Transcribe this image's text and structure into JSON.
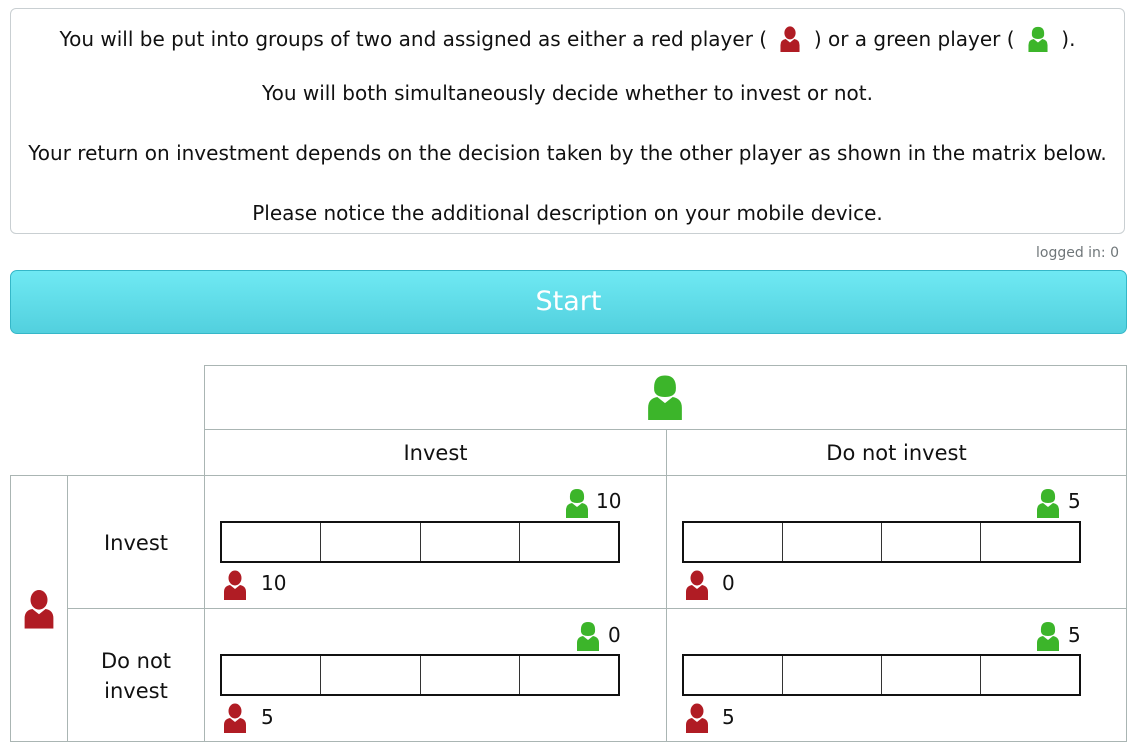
{
  "instructions": {
    "line1_before": "You will be put into groups of two and assigned as either a red player (",
    "line1_middle": ") or a green player (",
    "line1_after": ").",
    "line2": "You will both simultaneously decide whether to invest or not.",
    "line3": "Your return on investment depends on the decision taken by the other player as shown in the matrix below.",
    "line4": "Please notice the additional description on your mobile device."
  },
  "status": {
    "logged_in": "logged in: 0"
  },
  "start_button": {
    "label": "Start"
  },
  "colors": {
    "red_player": "#b01c24",
    "green_player": "#3cb52a",
    "button": "#5dddea"
  },
  "matrix": {
    "column_headers": [
      "Invest",
      "Do not invest"
    ],
    "row_headers": [
      "Invest",
      "Do not\ninvest"
    ],
    "cells": [
      {
        "green": "10",
        "red": "10"
      },
      {
        "green": "5",
        "red": "0"
      },
      {
        "green": "0",
        "red": "5"
      },
      {
        "green": "5",
        "red": "5"
      }
    ]
  }
}
